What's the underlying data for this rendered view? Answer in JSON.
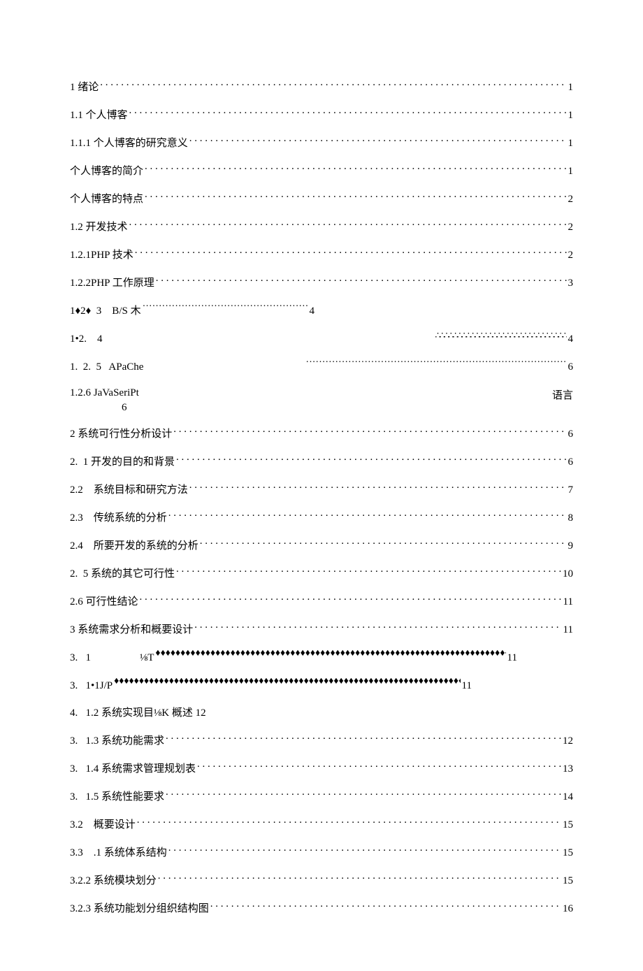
{
  "toc": [
    {
      "label": "1 绪论",
      "fill": "dots",
      "page": "1"
    },
    {
      "label": "1.1 个人博客",
      "fill": "dots",
      "page": "1"
    },
    {
      "label": "1.1.1 个人博客的研究意义",
      "fill": "dots",
      "page": "1"
    },
    {
      "label": "个人博客的简介",
      "fill": "dots",
      "page": "1"
    },
    {
      "label": "个人博客的特点",
      "fill": "dots",
      "page": "2"
    },
    {
      "label": "1.2 开发技术",
      "fill": "dots",
      "page": "2"
    },
    {
      "label": "1.2.1PHP 技术",
      "fill": "dots",
      "page": "2"
    },
    {
      "label": "1.2.2PHP 工作原理",
      "fill": "dots",
      "page": "3"
    },
    {
      "type": "inline",
      "label": "1♦2♦  3    B/S 木",
      "fill": "cdots",
      "page": "4",
      "short": true
    },
    {
      "type": "right",
      "label": "1•2.    4",
      "fill": "therefore",
      "page": "4"
    },
    {
      "type": "right",
      "label": "1.  2.  5   APaChe",
      "fill": "cdots",
      "page": "6",
      "indent": true
    },
    {
      "type": "tworow",
      "label": "1.2.6     JaVaSeriPt",
      "right": "语言",
      "second": "6"
    },
    {
      "label": "2 系统可行性分析设计",
      "fill": "dots",
      "page": "6"
    },
    {
      "label": "2.  1 开发的目的和背景",
      "fill": "dots",
      "page": "6"
    },
    {
      "label": "2.2    系统目标和研究方法",
      "fill": "dots",
      "page": "7"
    },
    {
      "label": "2.3    传统系统的分析",
      "fill": "dots",
      "page": "8"
    },
    {
      "label": "2.4    所要开发的系统的分析",
      "fill": "dots",
      "page": "9"
    },
    {
      "label": "2.  5 系统的其它可行性",
      "fill": "dots",
      "page": "10"
    },
    {
      "label": "2.6 可行性结论",
      "fill": "dots",
      "page": "11"
    },
    {
      "label": "3 系统需求分析和概要设计",
      "fill": "dots",
      "page": "11"
    },
    {
      "type": "dia1",
      "label": "3.   1",
      "mid": "⅛T",
      "page": "11"
    },
    {
      "type": "dia2",
      "label": "3.   1•1J/P",
      "page": "11"
    },
    {
      "type": "plain",
      "label": "4.   1.2 系统实现目⅛K 概述 12"
    },
    {
      "label": "3.   1.3 系统功能需求",
      "fill": "dots",
      "page": "12"
    },
    {
      "label": "3.   1.4 系统需求管理规划表",
      "fill": "dots",
      "page": "13"
    },
    {
      "label": "3.   1.5 系统性能要求",
      "fill": "dots",
      "page": "14"
    },
    {
      "label": "3.2    概要设计",
      "fill": "dots",
      "page": "15"
    },
    {
      "label": "3.3    .1 系统体系结构",
      "fill": "dots",
      "page": "15"
    },
    {
      "label": "3.2.2 系统模块划分",
      "fill": "dots",
      "page": "15"
    },
    {
      "label": "3.2.3 系统功能划分组织结构图",
      "fill": "dots",
      "page": "16"
    }
  ]
}
